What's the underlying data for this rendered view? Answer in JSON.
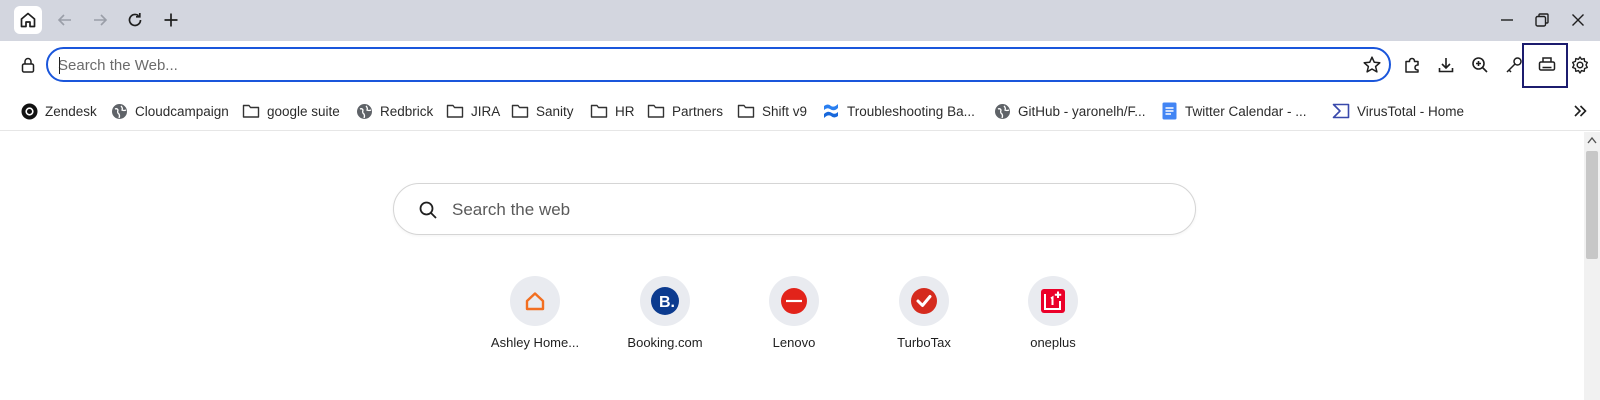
{
  "titlebar": {
    "tabs": [
      {
        "icon": "home-icon"
      }
    ],
    "nav": {
      "back": "back-arrow-icon",
      "forward": "forward-arrow-icon",
      "reload": "reload-icon",
      "new_tab": "plus-icon"
    },
    "window_controls": [
      "minimize-icon",
      "restore-icon",
      "close-icon"
    ]
  },
  "toolbar": {
    "address_placeholder": "Search the Web...",
    "address_value": "",
    "accent_color": "#1a56db",
    "tools": [
      "extensions-icon",
      "download-icon",
      "zoom-icon",
      "key-icon",
      "print-icon",
      "settings-icon"
    ],
    "highlighted_tool": "print-icon"
  },
  "bookmarks": {
    "items": [
      {
        "label": "Zendesk",
        "icon": "zendesk-icon"
      },
      {
        "label": "Cloudcampaign",
        "icon": "globe-icon"
      },
      {
        "label": "google suite",
        "icon": "folder-icon"
      },
      {
        "label": "Redbrick",
        "icon": "globe-icon"
      },
      {
        "label": "JIRA",
        "icon": "folder-icon"
      },
      {
        "label": "Sanity",
        "icon": "folder-icon"
      },
      {
        "label": "HR",
        "icon": "folder-icon"
      },
      {
        "label": "Partners",
        "icon": "folder-icon"
      },
      {
        "label": "Shift v9",
        "icon": "folder-icon"
      },
      {
        "label": "Troubleshooting Ba...",
        "icon": "confluence-icon"
      },
      {
        "label": "GitHub - yaronelh/F...",
        "icon": "globe-icon"
      },
      {
        "label": "Twitter Calendar - ...",
        "icon": "docs-icon"
      },
      {
        "label": "VirusTotal - Home",
        "icon": "virustotal-icon"
      }
    ],
    "overflow": "chevron-double-right-icon"
  },
  "content": {
    "search_placeholder": "Search the web",
    "speed_dials": [
      {
        "label": "Ashley Home...",
        "icon": "ashley-home-icon",
        "color": "#f26f21"
      },
      {
        "label": "Booking.com",
        "icon": "booking-icon",
        "color": "#0c3b8f"
      },
      {
        "label": "Lenovo",
        "icon": "lenovo-icon",
        "color": "#e2231a"
      },
      {
        "label": "TurboTax",
        "icon": "turbotax-icon",
        "color": "#d52b1e"
      },
      {
        "label": "oneplus",
        "icon": "oneplus-icon",
        "color": "#eb0029"
      }
    ]
  }
}
